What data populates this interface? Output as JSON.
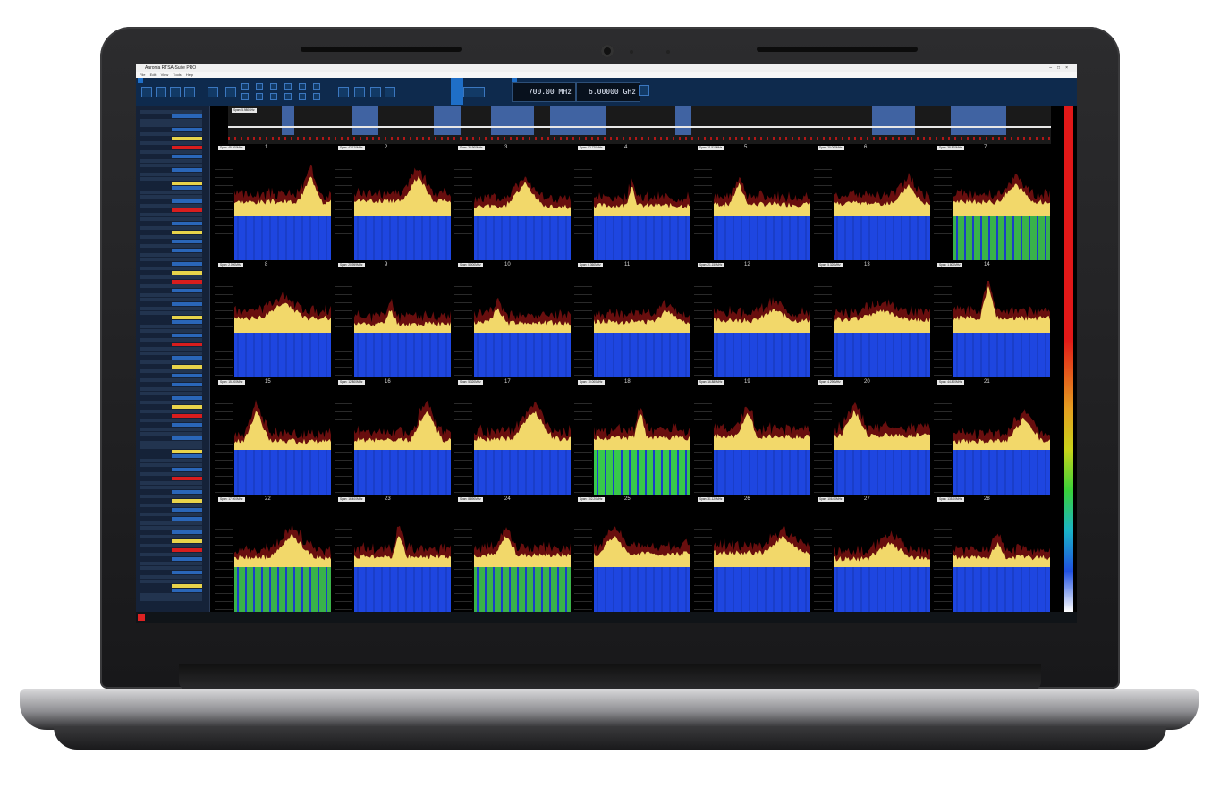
{
  "app": {
    "title": "Aaronia RTSA-Suite PRO",
    "menu": [
      "File",
      "Edit",
      "View",
      "Tools",
      "Help"
    ]
  },
  "tuner": {
    "span_value": "700.00 MHz",
    "center_value": "6.00000 GHz"
  },
  "overview": {
    "span_label": "Span: 5.980GHz"
  },
  "tiles": [
    {
      "num": "1",
      "span": "Span: 45.200MHz",
      "spec_color": "#f2d86a",
      "wf": "#1e46e0"
    },
    {
      "num": "2",
      "span": "Span: 42.120MHz",
      "spec_color": "#f2d86a",
      "wf": "#1e46e0"
    },
    {
      "num": "3",
      "span": "Span: 35.900MHz",
      "spec_color": "#f2d86a",
      "wf": "#1e46e0"
    },
    {
      "num": "4",
      "span": "Span: 52.720MHz",
      "spec_color": "#f2d86a",
      "wf": "#1e46e0"
    },
    {
      "num": "5",
      "span": "Span: 11.510MHz",
      "spec_color": "#f2d86a",
      "wf": "#1e46e0"
    },
    {
      "num": "6",
      "span": "Span: 20.000MHz",
      "spec_color": "#f2d86a",
      "wf": "#1e46e0"
    },
    {
      "num": "7",
      "span": "Span: 38.800MHz",
      "spec_color": "#f2d86a",
      "wf": "#39b24a"
    },
    {
      "num": "8",
      "span": "Span: 2.090MHz",
      "spec_color": "#f2d86a",
      "wf": "#1e46e0"
    },
    {
      "num": "9",
      "span": "Span: 20.959MHz",
      "spec_color": "#f2d86a",
      "wf": "#1e46e0"
    },
    {
      "num": "10",
      "span": "Span: 5.000MHz",
      "spec_color": "#f2d86a",
      "wf": "#1e46e0"
    },
    {
      "num": "11",
      "span": "Span: 6.360MHz",
      "spec_color": "#f2d86a",
      "wf": "#1e46e0"
    },
    {
      "num": "12",
      "span": "Span: 21.150MHz",
      "spec_color": "#f2d86a",
      "wf": "#1e46e0"
    },
    {
      "num": "13",
      "span": "Span: 5.320MHz",
      "spec_color": "#f2d86a",
      "wf": "#1e46e0"
    },
    {
      "num": "14",
      "span": "Span: 1.800MHz",
      "spec_color": "#f2d86a",
      "wf": "#1e46e0"
    },
    {
      "num": "15",
      "span": "Span: 15.200MHz",
      "spec_color": "#f2d86a",
      "wf": "#1e46e0"
    },
    {
      "num": "16",
      "span": "Span: 12.800MHz",
      "spec_color": "#f2d86a",
      "wf": "#1e46e0"
    },
    {
      "num": "17",
      "span": "Span: 5.320MHz",
      "spec_color": "#f2d86a",
      "wf": "#1e46e0"
    },
    {
      "num": "18",
      "span": "Span: 10.000MHz",
      "spec_color": "#f2d86a",
      "wf": "#38c84a"
    },
    {
      "num": "19",
      "span": "Span: 16.880MHz",
      "spec_color": "#f2d86a",
      "wf": "#1e46e0"
    },
    {
      "num": "20",
      "span": "Span: 4.290MHz",
      "spec_color": "#f2d86a",
      "wf": "#1e46e0"
    },
    {
      "num": "21",
      "span": "Span: 44.800MHz",
      "spec_color": "#f2d86a",
      "wf": "#1e46e0"
    },
    {
      "num": "22",
      "span": "Span: 17.900MHz",
      "spec_color": "#f2d86a",
      "wf": "#39b24a"
    },
    {
      "num": "23",
      "span": "Span: 16.400MHz",
      "spec_color": "#f2d86a",
      "wf": "#1e46e0"
    },
    {
      "num": "24",
      "span": "Span: 8.890MHz",
      "spec_color": "#f2d86a",
      "wf": "#39b24a"
    },
    {
      "num": "25",
      "span": "Span: 102.20MHz",
      "spec_color": "#f2d86a",
      "wf": "#1e46e0"
    },
    {
      "num": "26",
      "span": "Span: 31.120MHz",
      "spec_color": "#f2d86a",
      "wf": "#1e46e0"
    },
    {
      "num": "27",
      "span": "Span: 106.00MHz",
      "spec_color": "#f2d86a",
      "wf": "#1e46e0"
    },
    {
      "num": "28",
      "span": "Span: 135.00MHz",
      "spec_color": "#f2d86a",
      "wf": "#1e46e0"
    }
  ]
}
